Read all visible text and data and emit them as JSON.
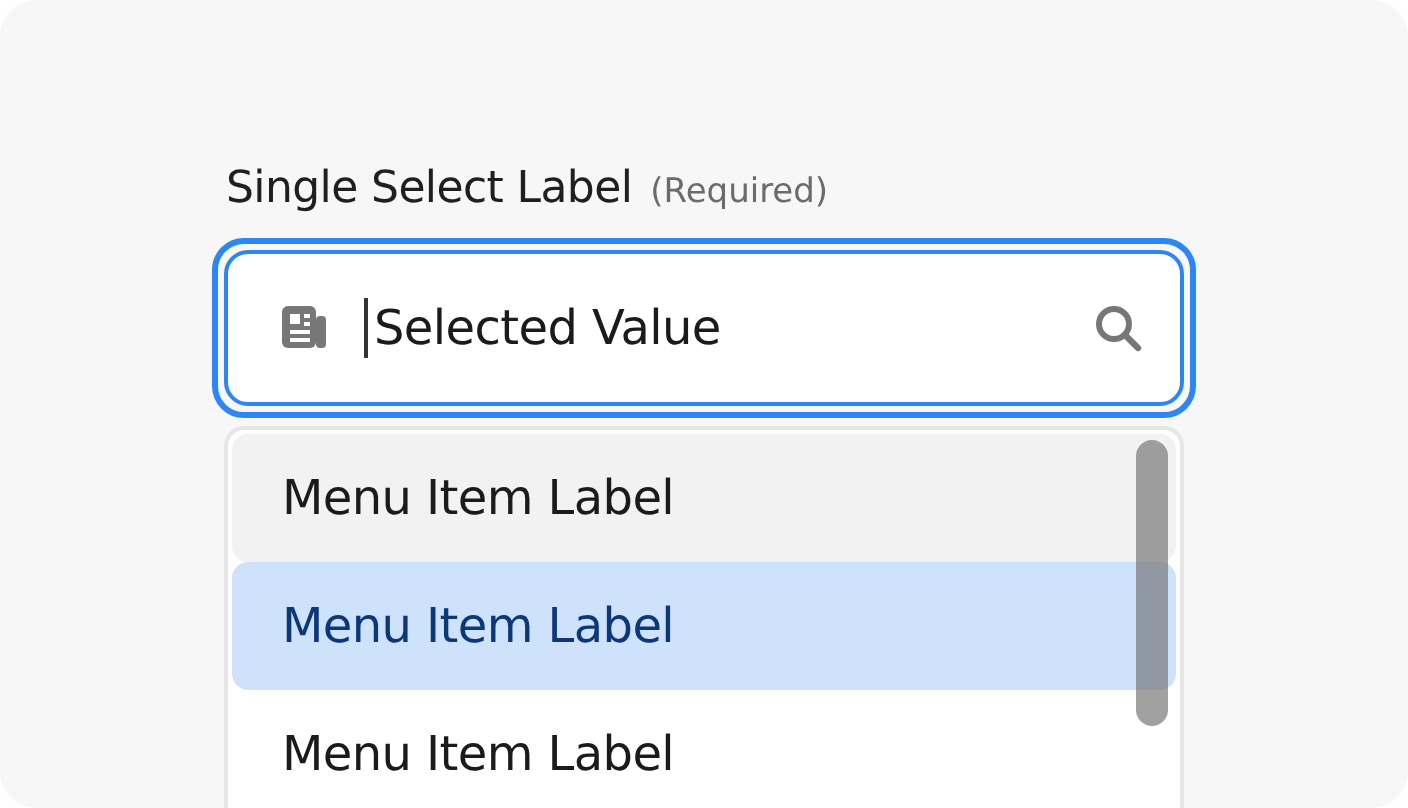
{
  "field": {
    "label": "Single Select Label",
    "hint": "(Required)",
    "value": "Selected Value",
    "focused": true
  },
  "menu": {
    "items": [
      {
        "label": "Menu Item Label",
        "hovered": true,
        "selected": false
      },
      {
        "label": "Menu Item Label",
        "hovered": false,
        "selected": true
      },
      {
        "label": "Menu Item Label",
        "hovered": false,
        "selected": false
      }
    ]
  }
}
